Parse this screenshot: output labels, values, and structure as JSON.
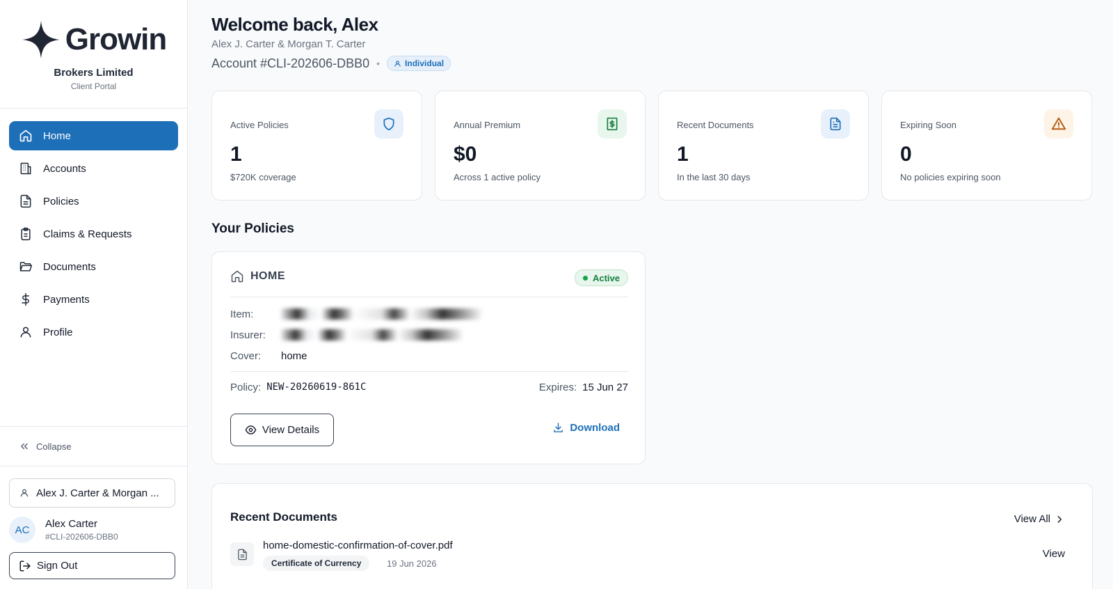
{
  "brand": {
    "logo_text": "Growin",
    "name": "Brokers Limited",
    "sub": "Client Portal"
  },
  "nav": {
    "items": [
      {
        "label": "Home",
        "icon": "home-icon",
        "active": true
      },
      {
        "label": "Accounts",
        "icon": "building-icon",
        "active": false
      },
      {
        "label": "Policies",
        "icon": "file-text-icon",
        "active": false
      },
      {
        "label": "Claims & Requests",
        "icon": "clipboard-icon",
        "active": false
      },
      {
        "label": "Documents",
        "icon": "folder-icon",
        "active": false
      },
      {
        "label": "Payments",
        "icon": "dollar-icon",
        "active": false
      },
      {
        "label": "Profile",
        "icon": "user-icon",
        "active": false
      }
    ],
    "collapse_label": "Collapse"
  },
  "account_selector": {
    "label": "Alex J. Carter & Morgan ..."
  },
  "user": {
    "initials": "AC",
    "name": "Alex Carter",
    "id": "#CLI-202606-DBB0"
  },
  "sign_out_label": "Sign Out",
  "header": {
    "greeting": "Welcome back, Alex",
    "names": "Alex J. Carter & Morgan T. Carter",
    "account": "Account #CLI-202606-DBB0",
    "separator": "•",
    "type_badge": "Individual"
  },
  "stats": [
    {
      "label": "Active Policies",
      "value": "1",
      "sub": "$720K coverage",
      "icon": "shield-icon",
      "color": "#1d6fb8",
      "bg": "#e8f1fb"
    },
    {
      "label": "Annual Premium",
      "value": "$0",
      "sub": "Across 1 active policy",
      "icon": "receipt-dollar-icon",
      "color": "#15803d",
      "bg": "#e9f6ee"
    },
    {
      "label": "Recent Documents",
      "value": "1",
      "sub": "In the last 30 days",
      "icon": "document-icon",
      "color": "#1d6fb8",
      "bg": "#e8f1fb"
    },
    {
      "label": "Expiring Soon",
      "value": "0",
      "sub": "No policies expiring soon",
      "icon": "warning-icon",
      "color": "#b45309",
      "bg": "#fdf3e7"
    }
  ],
  "policies_title": "Your Policies",
  "policy": {
    "type": "HOME",
    "status": "Active",
    "item_label": "Item:",
    "insurer_label": "Insurer:",
    "cover_label": "Cover:",
    "cover_value": "home",
    "policy_label": "Policy:",
    "policy_number": "NEW-20260619-861C",
    "expires_label": "Expires:",
    "expires_value": "15 Jun 27",
    "view_details": "View Details",
    "download": "Download"
  },
  "documents": {
    "title": "Recent Documents",
    "view_all": "View All",
    "items": [
      {
        "name": "home-domestic-confirmation-of-cover.pdf",
        "tag": "Certificate of Currency",
        "date": "19 Jun 2026",
        "action": "View"
      }
    ]
  }
}
